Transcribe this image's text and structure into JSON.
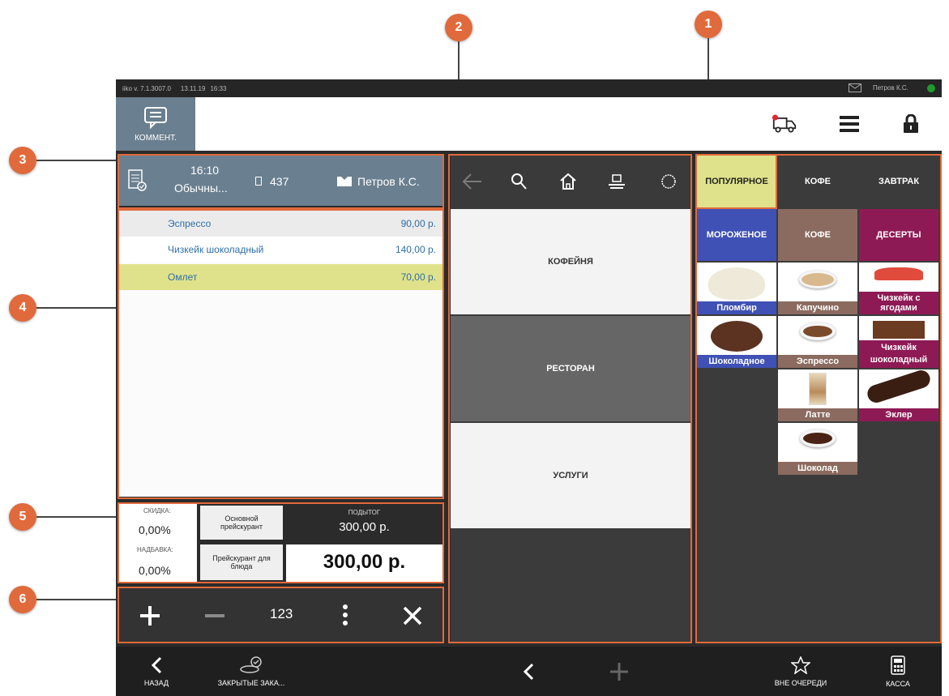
{
  "statusbar": {
    "version": "iiko v. 7.1.3007.0",
    "date": "13.11.19",
    "time": "16:33",
    "user": "Петров К.С."
  },
  "toolbar": {
    "comment_label": "КОММЕНТ."
  },
  "order_header": {
    "time": "16:10",
    "type": "Обычны...",
    "number": "437",
    "waiter": "Петров К.С."
  },
  "order_items": [
    {
      "name": "Эспрессо",
      "price": "90,00 р."
    },
    {
      "name": "Чизкейк шоколадный",
      "price": "140,00 р."
    },
    {
      "name": "Омлет",
      "price": "70,00 р."
    }
  ],
  "totals": {
    "discount_label": "СКИДКА:",
    "discount_value": "0,00%",
    "markup_label": "НАДБАВКА:",
    "markup_value": "0,00%",
    "price_list_main": "Основной прейскурант",
    "price_list_dish": "Прейскурант для блюда",
    "subtotal_label": "ПОДЫТОГ",
    "subtotal_value": "300,00 р.",
    "total_value": "300,00 р."
  },
  "actions": {
    "numpad_label": "123"
  },
  "nav": {
    "sections": [
      "КОФЕЙНЯ",
      "РЕСТОРАН",
      "УСЛУГИ"
    ]
  },
  "menu": {
    "tabs": [
      "ПОПУЛЯРНОЕ",
      "КОФЕ",
      "ЗАВТРАК"
    ],
    "categories": [
      "МОРОЖЕНОЕ",
      "КОФЕ",
      "ДЕСЕРТЫ"
    ],
    "items": [
      "Пломбир",
      "Капучино",
      "Чизкейк с ягодами",
      "Шоколадное",
      "Эспрессо",
      "Чизкейк шоколадный",
      "Латте",
      "Эклер",
      "Шоколад"
    ]
  },
  "bottombar": {
    "back_label": "НАЗАД",
    "closed_orders_label": "ЗАКРЫТЫЕ ЗАКА...",
    "priority_label": "ВНЕ ОЧЕРЕДИ",
    "cashier_label": "КАССА"
  },
  "callouts": [
    "1",
    "2",
    "3",
    "4",
    "5",
    "6"
  ],
  "colors": {
    "accent": "#e06a3c",
    "header": "#6a7f8f",
    "selected_row": "#dfe28a",
    "ice_cream": "#3f51b5",
    "coffee": "#8b6b5f",
    "desserts": "#8e1a55"
  }
}
